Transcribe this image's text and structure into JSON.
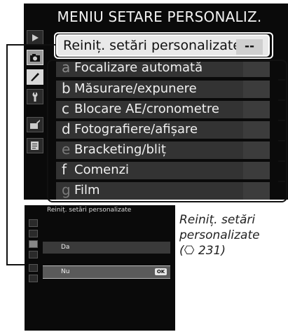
{
  "main_screen": {
    "title": "MENIU SETARE PERSONALIZ.",
    "reset_row": {
      "label": "Reiniț. setări personalizate",
      "value": "--"
    },
    "items": [
      {
        "letter": "a",
        "label": "Focalizare automată",
        "letter_dim": true
      },
      {
        "letter": "b",
        "label": "Măsurare/expunere",
        "letter_dim": false
      },
      {
        "letter": "c",
        "label": "Blocare AE/cronometre",
        "letter_dim": false
      },
      {
        "letter": "d",
        "label": "Fotografiere/afișare",
        "letter_dim": false
      },
      {
        "letter": "e",
        "label": "Bracketing/bliț",
        "letter_dim": true
      },
      {
        "letter": "f",
        "label": "Comenzi",
        "letter_dim": false
      },
      {
        "letter": "g",
        "label": "Film",
        "letter_dim": true
      }
    ],
    "side_tabs": [
      "playback-icon",
      "camera-icon",
      "pencil-icon",
      "wrench-icon",
      "retouch-icon",
      "recent-settings-icon"
    ]
  },
  "small_screen": {
    "title": "Reiniț. setări personalizate",
    "options": [
      {
        "label": "Da",
        "selected": false
      },
      {
        "label": "Nu",
        "selected": true,
        "ok": "OK"
      }
    ]
  },
  "caption": {
    "line1": "Reiniț. setări",
    "line2": "personalizate",
    "line3": "(⎔ 231)"
  },
  "colors": {
    "screen_bg": "#0a0a0a",
    "row_bg": "#333333",
    "highlight_bg": "#e9e9e9"
  }
}
